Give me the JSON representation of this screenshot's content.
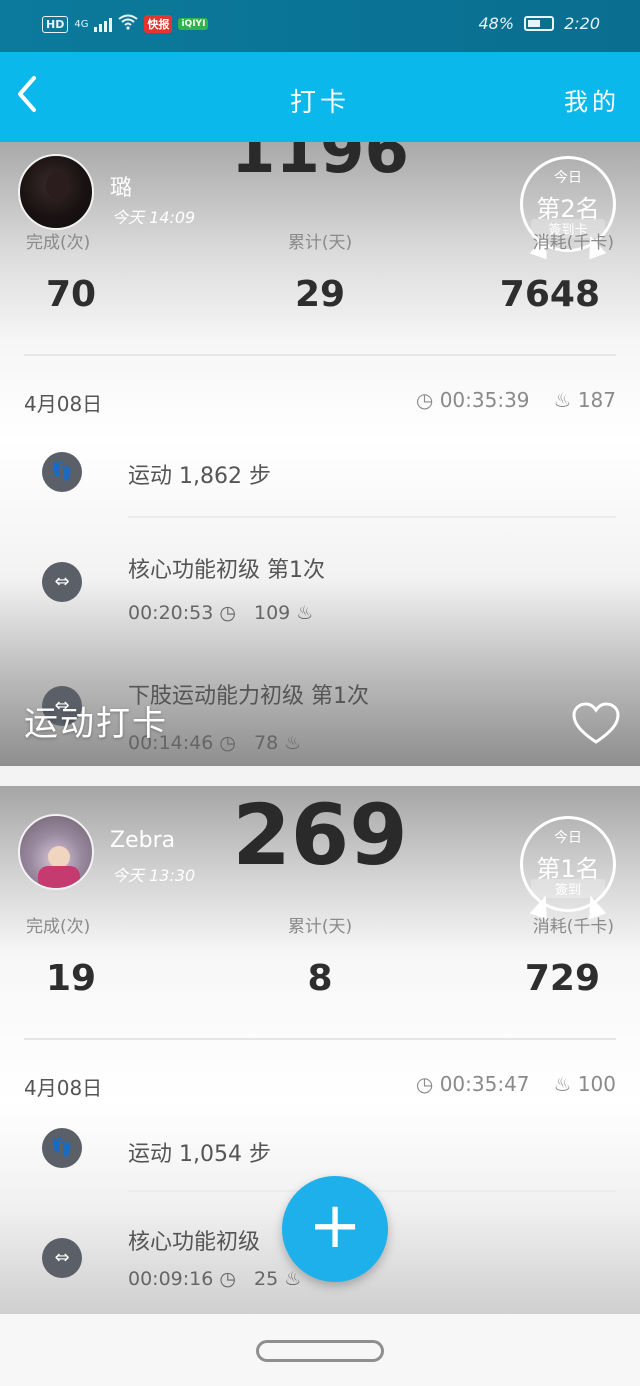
{
  "statusbar": {
    "left": {
      "hd": "HD",
      "net": "4G",
      "app1": "快报",
      "app2": "iQIYI"
    },
    "battery": "48%",
    "time": "2:20"
  },
  "nav": {
    "back": "<",
    "title": "打卡",
    "mine": "我的"
  },
  "cards": [
    {
      "big_number": "1196",
      "user": {
        "name": "璐",
        "time": "今天 14:09"
      },
      "badge": {
        "today": "今日",
        "rank": "第2名",
        "sign": "簽到卡"
      },
      "stats": [
        {
          "label": "完成(次)",
          "value": "70"
        },
        {
          "label": "累计(天)",
          "value": "29"
        },
        {
          "label": "消耗(千卡)",
          "value": "7648"
        }
      ],
      "date": "4月08日",
      "duration": "00:35:39",
      "calories": "187",
      "activities": [
        {
          "title": "运动 1,862 步"
        },
        {
          "title": "核心功能初级 第1次",
          "time": "00:20:53",
          "cal": "109"
        },
        {
          "title": "下肢运动能力初级 第1次",
          "time": "00:14:46",
          "cal": "78"
        }
      ],
      "overlay_title": "运动打卡"
    },
    {
      "big_number": "269",
      "user": {
        "name": "Zebra",
        "time": "今天 13:30"
      },
      "badge": {
        "today": "今日",
        "rank": "第1名",
        "sign": "簽到"
      },
      "stats": [
        {
          "label": "完成(次)",
          "value": "19"
        },
        {
          "label": "累计(天)",
          "value": "8"
        },
        {
          "label": "消耗(千卡)",
          "value": "729"
        }
      ],
      "date": "4月08日",
      "duration": "00:35:47",
      "calories": "100",
      "activities": [
        {
          "title": "运动 1,054 步"
        },
        {
          "title": "核心功能初级",
          "time": "00:09:16",
          "cal": "25"
        }
      ]
    }
  ],
  "fab": {
    "label": "+"
  },
  "colors": {
    "primary": "#0bb8ec",
    "statusbar": "#0b7a9c",
    "fab": "#1eb0ea"
  }
}
